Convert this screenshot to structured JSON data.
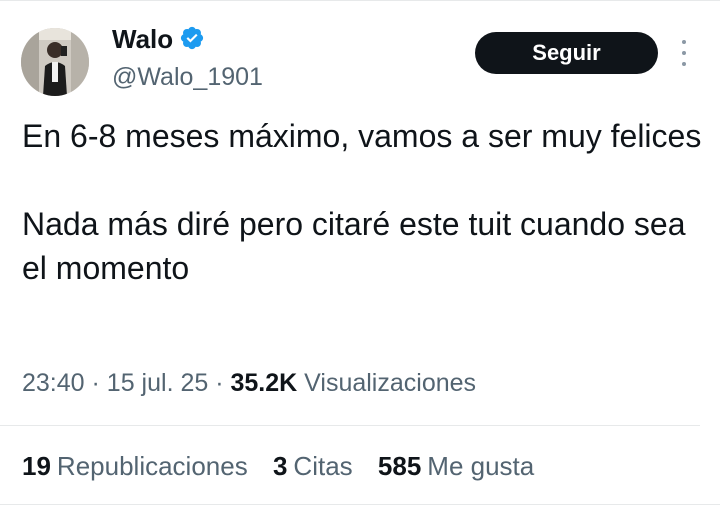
{
  "user": {
    "name": "Walo",
    "handle": "@Walo_1901",
    "verified": true
  },
  "follow_button": {
    "label": "Seguir"
  },
  "tweet": {
    "paragraphs": [
      "En 6-8 meses máximo, vamos a ser muy felices",
      "Nada más diré pero citaré este tuit cuando sea el momento"
    ],
    "time": "23:40",
    "date": "15 jul. 25",
    "views_count": "35.2K",
    "views_label": "Visualizaciones"
  },
  "stats": {
    "reposts_count": "19",
    "reposts_label": "Republicaciones",
    "quotes_count": "3",
    "quotes_label": "Citas",
    "likes_count": "585",
    "likes_label": "Me gusta"
  },
  "colors": {
    "verified_badge": "#1d9bf0",
    "follow_button_bg": "#0f1419",
    "secondary_text": "#536471"
  },
  "icons": {
    "verified": "verified-badge-icon",
    "more": "more-options-icon"
  }
}
